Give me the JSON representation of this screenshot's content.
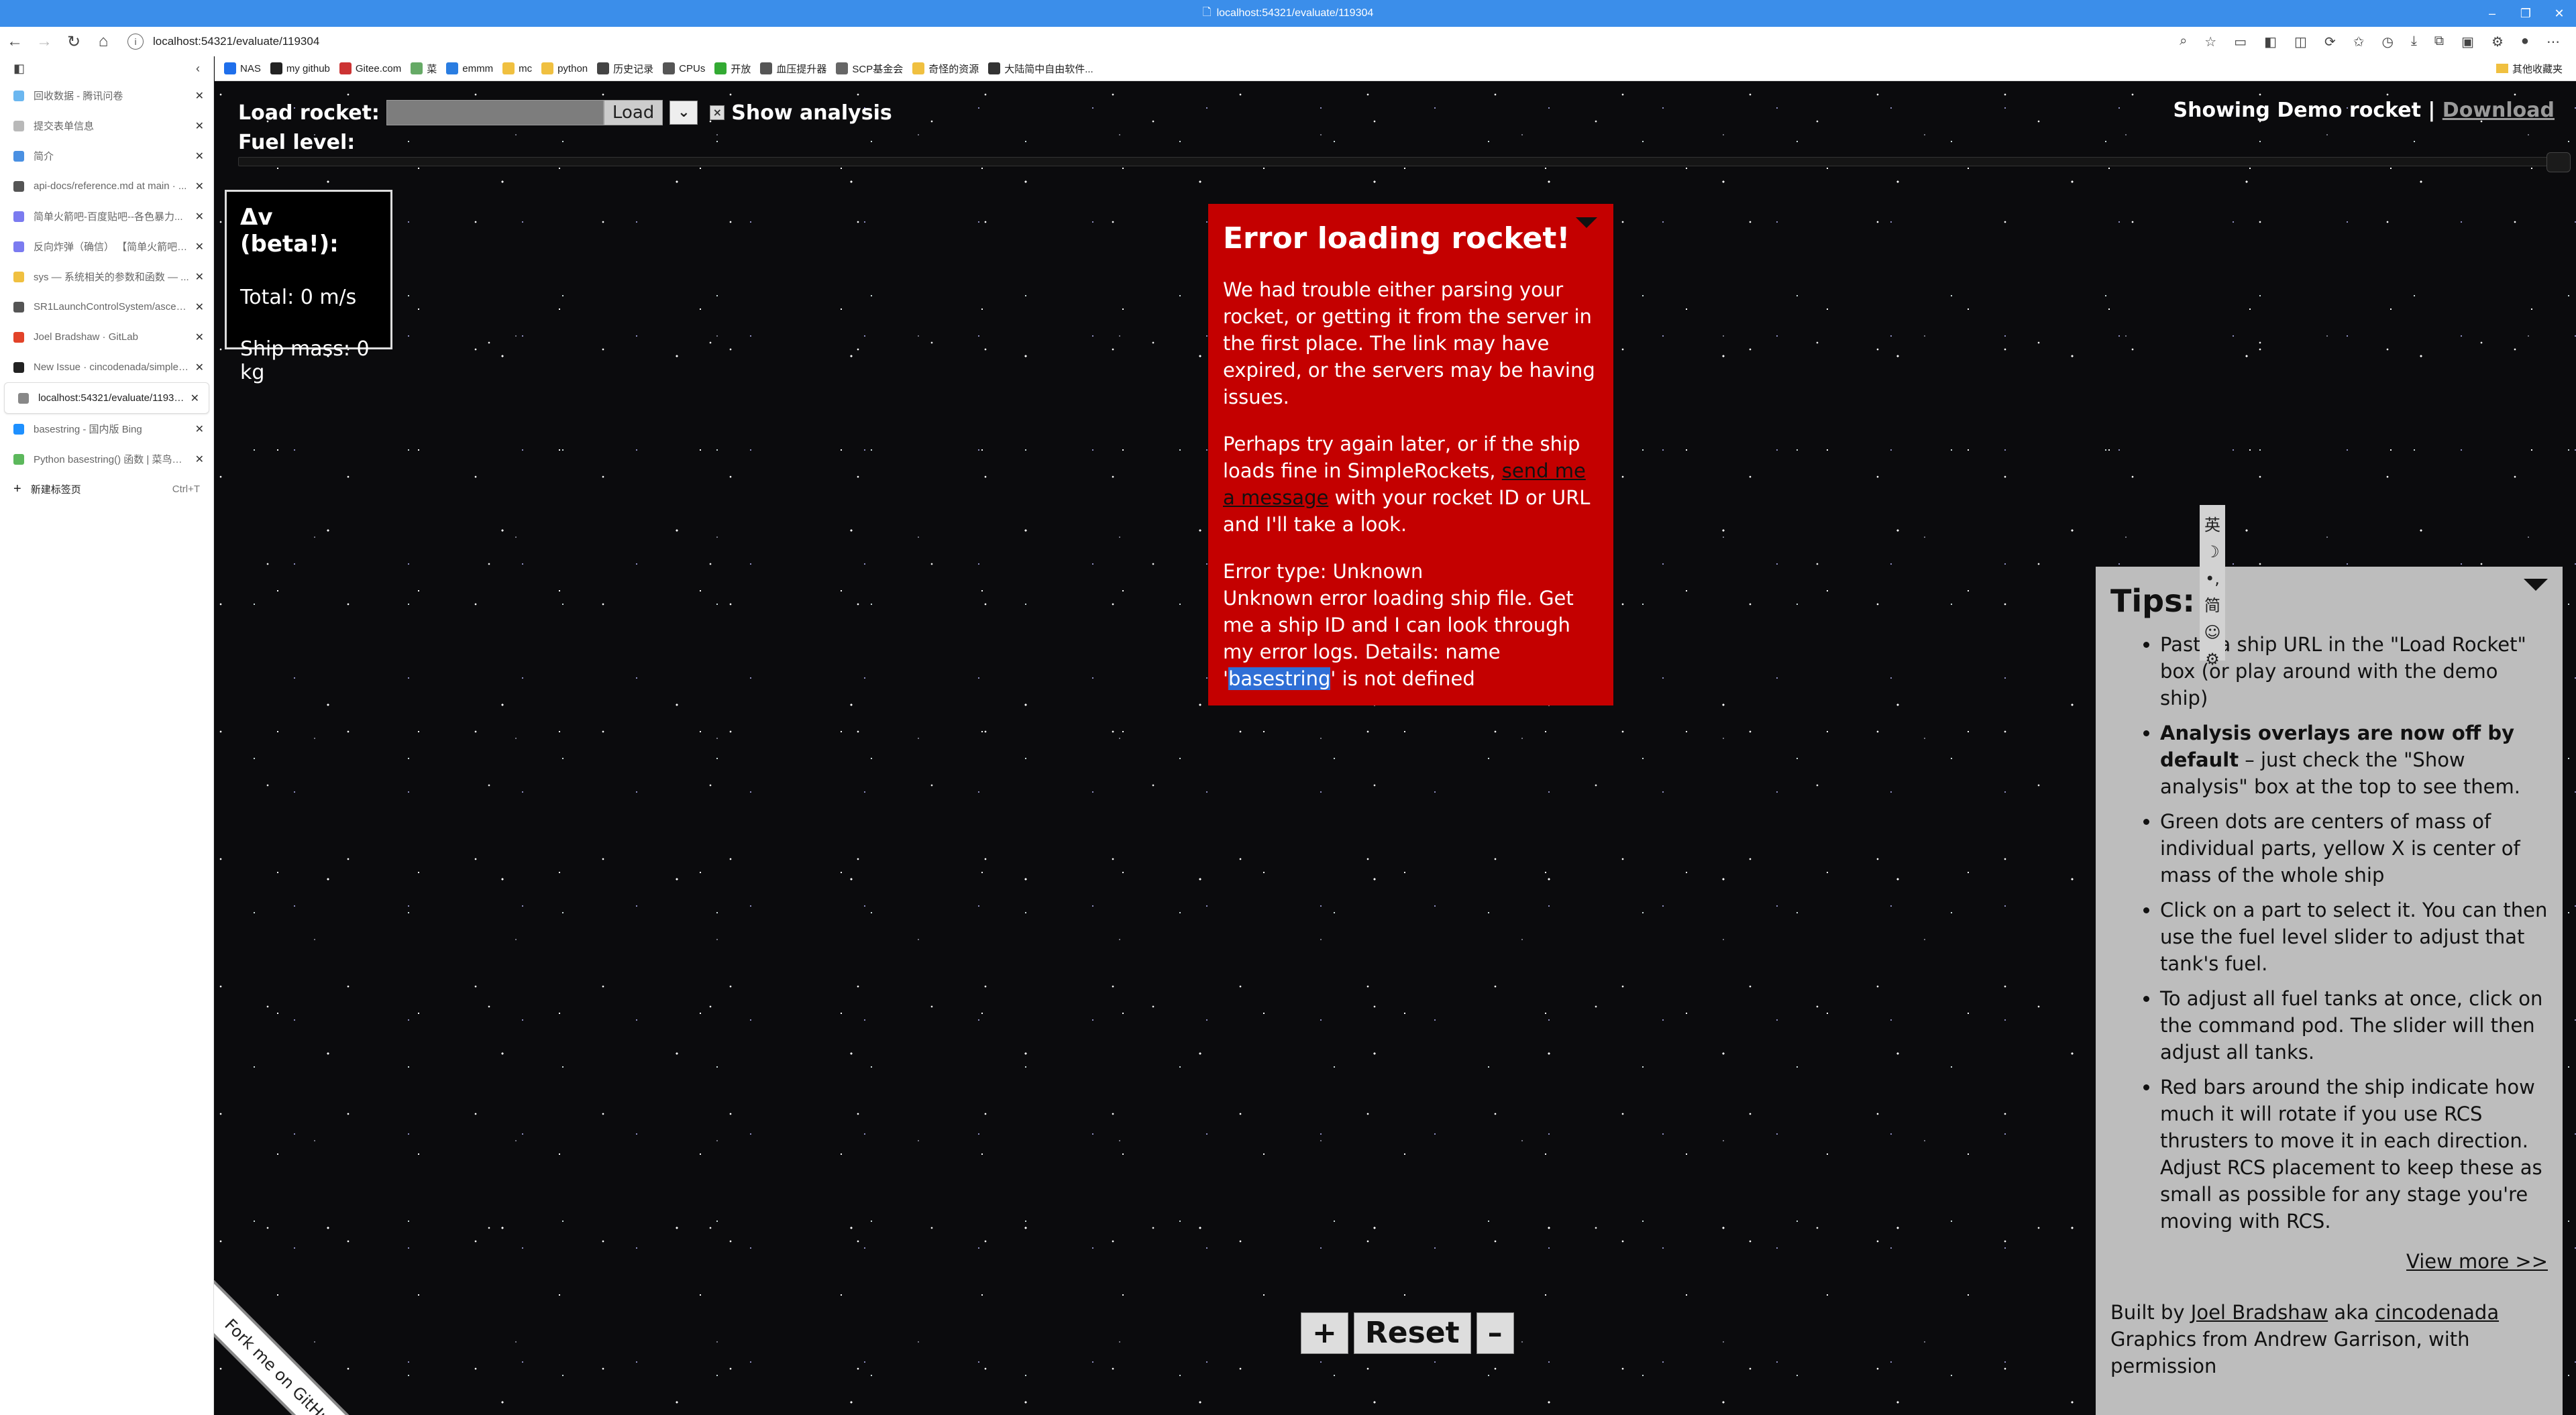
{
  "browser": {
    "window_title": "localhost:54321/evaluate/119304",
    "address": "localhost:54321/evaluate/119304"
  },
  "bookmarks": [
    "NAS",
    "my github",
    "Gitee.com",
    "菜",
    "emmm",
    "mc",
    "python",
    "历史记录",
    "CPUs",
    "开放",
    "血压提升器",
    "SCP基金会",
    "奇怪的资源",
    "大陆简中自由软件..."
  ],
  "bookmarks_other": "其他收藏夹",
  "tabs": [
    {
      "title": "回收数据 - 腾讯问卷",
      "color": "#6bb7f0"
    },
    {
      "title": "提交表单信息",
      "color": "#b9b9b9"
    },
    {
      "title": "简介",
      "color": "#4a90e2"
    },
    {
      "title": "api-docs/reference.md at main · ...",
      "color": "#555"
    },
    {
      "title": "简单火箭吧-百度贴吧--各色暴力...",
      "color": "#7b7bf0"
    },
    {
      "title": "反向炸弹（确信） 【简单火箭吧】...",
      "color": "#7b7bf0"
    },
    {
      "title": "sys — 系统相关的参数和函数 — ...",
      "color": "#f0c040"
    },
    {
      "title": "SR1LaunchControlSystem/ascent...",
      "color": "#555"
    },
    {
      "title": "Joel Bradshaw · GitLab",
      "color": "#e24329"
    },
    {
      "title": "New Issue · cincodenada/simple-...",
      "color": "#222"
    },
    {
      "title": "localhost:54321/evaluate/119304",
      "color": "#888"
    },
    {
      "title": "basestring - 国内版 Bing",
      "color": "#1e90ff"
    },
    {
      "title": "Python basestring() 函数 | 菜鸟教...",
      "color": "#5cb85c"
    }
  ],
  "new_tab": {
    "label": "新建标签页",
    "shortcut": "Ctrl+T"
  },
  "app": {
    "load_label": "Load rocket:",
    "load_button": "Load",
    "show_analysis": "Show analysis",
    "fuel_label": "Fuel level:",
    "showing": "Showing Demo rocket |",
    "download": "Download"
  },
  "dv": {
    "title": "Δv (beta!):",
    "total": "Total: 0 m/s",
    "mass": "Ship mass: 0 kg"
  },
  "error": {
    "title": "Error loading rocket!",
    "p1": "We had trouble either parsing your rocket, or getting it from the server in the first place. The link may have expired, or the servers may be having issues.",
    "p2_a": "Perhaps try again later, or if the ship loads fine in SimpleRockets, ",
    "p2_link": "send me a message",
    "p2_b": " with your rocket ID or URL and I'll take a look.",
    "type": "Error type: Unknown",
    "detail_a": "Unknown error loading ship file. Get me a ship ID and I can look through my error logs. Details: name '",
    "detail_hl": "basestring",
    "detail_b": "' is not defined"
  },
  "ime": [
    "英",
    "☽",
    "•,",
    "简",
    "☺",
    "⚙"
  ],
  "tips": {
    "title": "Tips:",
    "items": [
      {
        "text": "Paste a ship URL in the \"Load Rocket\" box (or play around with the demo ship)"
      },
      {
        "bold": "Analysis overlays are now off by default",
        "text": " – just check the \"Show analysis\" box at the top to see them."
      },
      {
        "text": "Green dots are centers of mass of individual parts, yellow X is center of mass of the whole ship"
      },
      {
        "text": "Click on a part to select it. You can then use the fuel level slider to adjust that tank's fuel."
      },
      {
        "text": "To adjust all fuel tanks at once, click on the command pod. The slider will then adjust all tanks."
      },
      {
        "text": "Red bars around the ship indicate how much it will rotate if you use RCS thrusters to move it in each direction. Adjust RCS placement to keep these as small as possible for any stage you're moving with RCS."
      }
    ],
    "more": "View more >>",
    "built_by": "Built by ",
    "author": "Joel Bradshaw",
    "aka": " aka ",
    "handle": "cincodenada",
    "graphics": "Graphics from Andrew Garrison, with permission"
  },
  "controls": {
    "plus": "+",
    "reset": "Reset",
    "minus": "–"
  },
  "ribbon": "Fork me on GitHub"
}
